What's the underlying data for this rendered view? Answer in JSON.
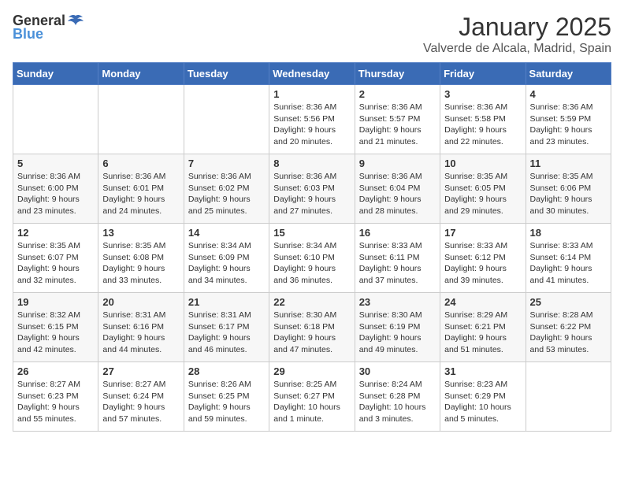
{
  "logo": {
    "general": "General",
    "blue": "Blue"
  },
  "header": {
    "month": "January 2025",
    "location": "Valverde de Alcala, Madrid, Spain"
  },
  "weekdays": [
    "Sunday",
    "Monday",
    "Tuesday",
    "Wednesday",
    "Thursday",
    "Friday",
    "Saturday"
  ],
  "weeks": [
    [
      {
        "day": "",
        "info": ""
      },
      {
        "day": "",
        "info": ""
      },
      {
        "day": "",
        "info": ""
      },
      {
        "day": "1",
        "info": "Sunrise: 8:36 AM\nSunset: 5:56 PM\nDaylight: 9 hours\nand 20 minutes."
      },
      {
        "day": "2",
        "info": "Sunrise: 8:36 AM\nSunset: 5:57 PM\nDaylight: 9 hours\nand 21 minutes."
      },
      {
        "day": "3",
        "info": "Sunrise: 8:36 AM\nSunset: 5:58 PM\nDaylight: 9 hours\nand 22 minutes."
      },
      {
        "day": "4",
        "info": "Sunrise: 8:36 AM\nSunset: 5:59 PM\nDaylight: 9 hours\nand 23 minutes."
      }
    ],
    [
      {
        "day": "5",
        "info": "Sunrise: 8:36 AM\nSunset: 6:00 PM\nDaylight: 9 hours\nand 23 minutes."
      },
      {
        "day": "6",
        "info": "Sunrise: 8:36 AM\nSunset: 6:01 PM\nDaylight: 9 hours\nand 24 minutes."
      },
      {
        "day": "7",
        "info": "Sunrise: 8:36 AM\nSunset: 6:02 PM\nDaylight: 9 hours\nand 25 minutes."
      },
      {
        "day": "8",
        "info": "Sunrise: 8:36 AM\nSunset: 6:03 PM\nDaylight: 9 hours\nand 27 minutes."
      },
      {
        "day": "9",
        "info": "Sunrise: 8:36 AM\nSunset: 6:04 PM\nDaylight: 9 hours\nand 28 minutes."
      },
      {
        "day": "10",
        "info": "Sunrise: 8:35 AM\nSunset: 6:05 PM\nDaylight: 9 hours\nand 29 minutes."
      },
      {
        "day": "11",
        "info": "Sunrise: 8:35 AM\nSunset: 6:06 PM\nDaylight: 9 hours\nand 30 minutes."
      }
    ],
    [
      {
        "day": "12",
        "info": "Sunrise: 8:35 AM\nSunset: 6:07 PM\nDaylight: 9 hours\nand 32 minutes."
      },
      {
        "day": "13",
        "info": "Sunrise: 8:35 AM\nSunset: 6:08 PM\nDaylight: 9 hours\nand 33 minutes."
      },
      {
        "day": "14",
        "info": "Sunrise: 8:34 AM\nSunset: 6:09 PM\nDaylight: 9 hours\nand 34 minutes."
      },
      {
        "day": "15",
        "info": "Sunrise: 8:34 AM\nSunset: 6:10 PM\nDaylight: 9 hours\nand 36 minutes."
      },
      {
        "day": "16",
        "info": "Sunrise: 8:33 AM\nSunset: 6:11 PM\nDaylight: 9 hours\nand 37 minutes."
      },
      {
        "day": "17",
        "info": "Sunrise: 8:33 AM\nSunset: 6:12 PM\nDaylight: 9 hours\nand 39 minutes."
      },
      {
        "day": "18",
        "info": "Sunrise: 8:33 AM\nSunset: 6:14 PM\nDaylight: 9 hours\nand 41 minutes."
      }
    ],
    [
      {
        "day": "19",
        "info": "Sunrise: 8:32 AM\nSunset: 6:15 PM\nDaylight: 9 hours\nand 42 minutes."
      },
      {
        "day": "20",
        "info": "Sunrise: 8:31 AM\nSunset: 6:16 PM\nDaylight: 9 hours\nand 44 minutes."
      },
      {
        "day": "21",
        "info": "Sunrise: 8:31 AM\nSunset: 6:17 PM\nDaylight: 9 hours\nand 46 minutes."
      },
      {
        "day": "22",
        "info": "Sunrise: 8:30 AM\nSunset: 6:18 PM\nDaylight: 9 hours\nand 47 minutes."
      },
      {
        "day": "23",
        "info": "Sunrise: 8:30 AM\nSunset: 6:19 PM\nDaylight: 9 hours\nand 49 minutes."
      },
      {
        "day": "24",
        "info": "Sunrise: 8:29 AM\nSunset: 6:21 PM\nDaylight: 9 hours\nand 51 minutes."
      },
      {
        "day": "25",
        "info": "Sunrise: 8:28 AM\nSunset: 6:22 PM\nDaylight: 9 hours\nand 53 minutes."
      }
    ],
    [
      {
        "day": "26",
        "info": "Sunrise: 8:27 AM\nSunset: 6:23 PM\nDaylight: 9 hours\nand 55 minutes."
      },
      {
        "day": "27",
        "info": "Sunrise: 8:27 AM\nSunset: 6:24 PM\nDaylight: 9 hours\nand 57 minutes."
      },
      {
        "day": "28",
        "info": "Sunrise: 8:26 AM\nSunset: 6:25 PM\nDaylight: 9 hours\nand 59 minutes."
      },
      {
        "day": "29",
        "info": "Sunrise: 8:25 AM\nSunset: 6:27 PM\nDaylight: 10 hours\nand 1 minute."
      },
      {
        "day": "30",
        "info": "Sunrise: 8:24 AM\nSunset: 6:28 PM\nDaylight: 10 hours\nand 3 minutes."
      },
      {
        "day": "31",
        "info": "Sunrise: 8:23 AM\nSunset: 6:29 PM\nDaylight: 10 hours\nand 5 minutes."
      },
      {
        "day": "",
        "info": ""
      }
    ]
  ]
}
